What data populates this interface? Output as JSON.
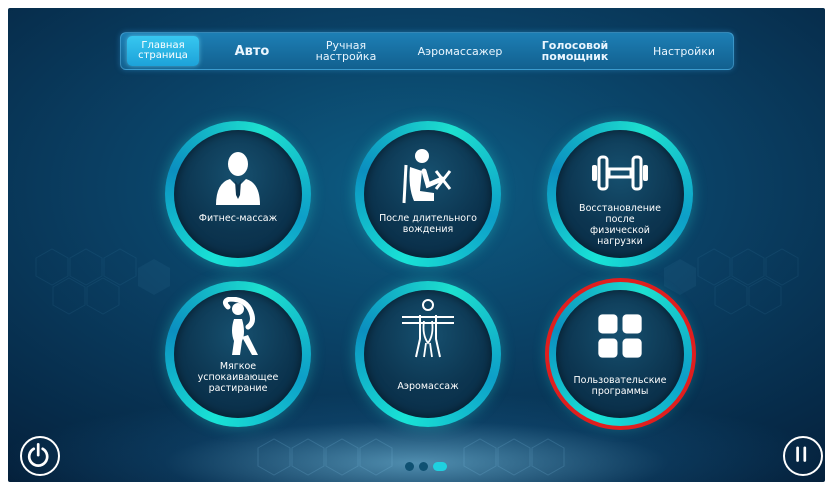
{
  "nav": {
    "tabs": [
      {
        "label": "Главная\nстраница",
        "active": true
      },
      {
        "label": "Авто",
        "active": false
      },
      {
        "label": "Ручная\nнастройка",
        "active": false
      },
      {
        "label": "Аэромассажер",
        "active": false
      },
      {
        "label": "Голосовой\nпомощник",
        "active": false
      },
      {
        "label": "Настройки",
        "active": false
      }
    ]
  },
  "tiles": [
    {
      "label": "Фитнес-массаж",
      "icon": "businessman-icon"
    },
    {
      "label": "После длительного\nвождения",
      "icon": "seated-driver-icon"
    },
    {
      "label": "Восстановление после\nфизической\nнагрузки",
      "icon": "dumbbell-icon"
    },
    {
      "label": "Мягкое\nуспокаивающее\nрастирание",
      "icon": "stretching-person-icon"
    },
    {
      "label": "Аэромассаж",
      "icon": "body-airflow-icon"
    },
    {
      "label": "Пользовательские\nпрограммы",
      "icon": "grid-icon"
    }
  ],
  "pager": {
    "pages": 3,
    "current": 3
  },
  "colors": {
    "accent": "#19e3d6",
    "highlight": "#e01e1e",
    "nav_bg": "#12608f",
    "active_tab": "#1da2d9"
  },
  "controls": {
    "power_icon": "power-icon",
    "pause_icon": "pause-icon"
  }
}
